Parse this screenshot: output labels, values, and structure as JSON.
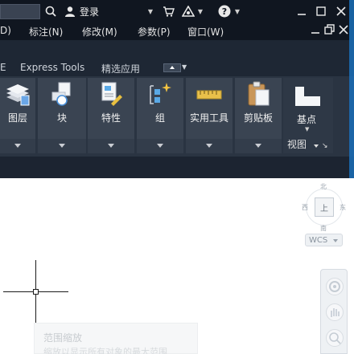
{
  "titlebar": {
    "login_label": "登录"
  },
  "menubar": {
    "items": [
      "D)",
      "标注(N)",
      "修改(M)",
      "参数(P)",
      "窗口(W)"
    ]
  },
  "ribbon_tabs": [
    "E",
    "Express Tools",
    "精选应用"
  ],
  "ribbon": {
    "panels": [
      "图层",
      "块",
      "特性",
      "组",
      "实用工具",
      "剪贴板"
    ],
    "base_label": "基点",
    "view_label": "视图"
  },
  "viewcube": {
    "north": "北",
    "south": "南",
    "east": "东",
    "west": "西",
    "face": "上"
  },
  "wcs_label": "WCS",
  "tooltip": {
    "title": "范围缩放",
    "desc": "缩放以显示所有对象的最大范围"
  },
  "colors": {
    "title_bg": "#101620",
    "ribbon_bg": "#2a3442",
    "panel_bg": "#3a4452",
    "accent": "#1a6fb8"
  }
}
